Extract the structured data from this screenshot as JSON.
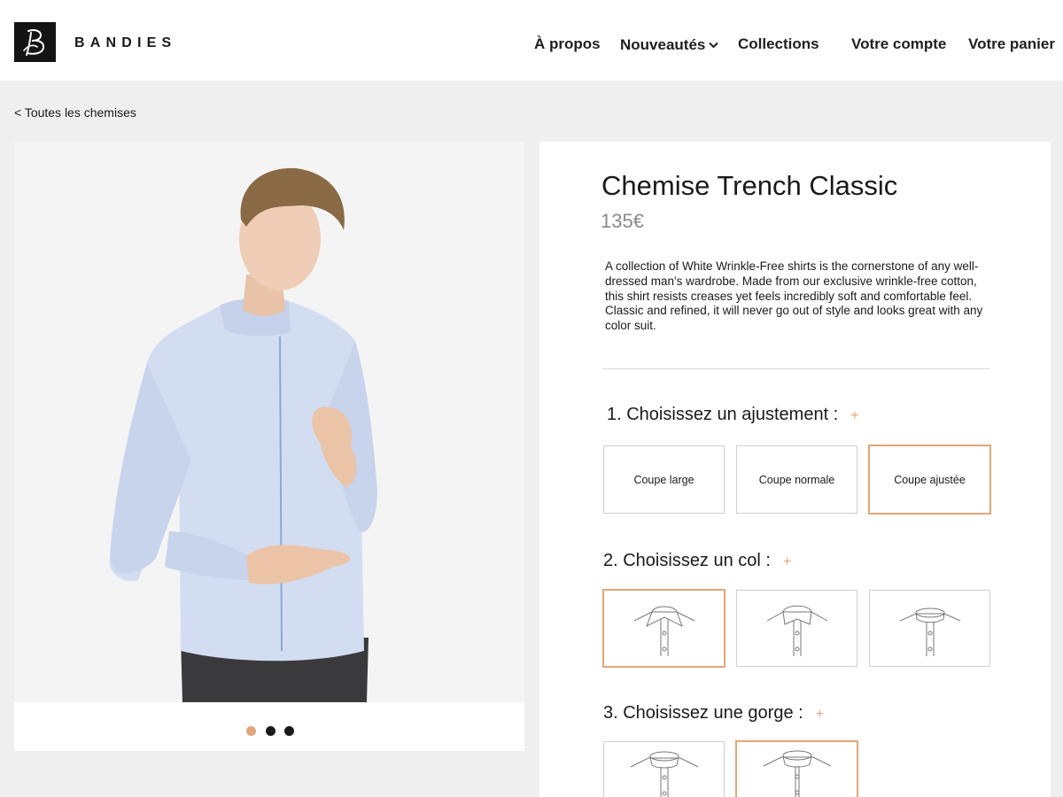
{
  "header": {
    "brand": "BANDIES",
    "logo_icon": "b-monogram-logo-icon",
    "nav": {
      "a_propos": "À propos",
      "nouveautes": "Nouveautés",
      "collections": "Collections",
      "compte": "Votre compte",
      "panier": "Votre panier"
    }
  },
  "breadcrumb": "< Toutes les chemises",
  "gallery": {
    "photo_icon": "model-wearing-shirt-photo",
    "dots_count": 3,
    "active_dot": 1
  },
  "product": {
    "title": "Chemise Trench Classic",
    "price": "135€",
    "description": "A collection of White Wrinkle-Free shirts is the cornerstone of any well-dressed man's wardrobe. Made from our exclusive wrinkle-free cotton, this shirt resists creases yet feels incredibly soft and comfortable feel. Classic and refined, it will never go out of style and looks great with any color suit."
  },
  "steps": {
    "fit": {
      "label": "1. Choisissez un ajustement :",
      "plus": "+",
      "options": [
        "Coupe large",
        "Coupe normale",
        "Coupe ajustée"
      ],
      "selected": "Coupe ajustée"
    },
    "collar": {
      "label": "2. Choisissez un col :",
      "plus": "+",
      "options_icons": [
        "classic-collar-icon",
        "cutaway-collar-icon",
        "mandarin-collar-icon"
      ],
      "selected_index": 0
    },
    "placket": {
      "label": "3. Choisissez une gorge :",
      "plus": "+",
      "options_icons": [
        "standard-placket-icon",
        "french-placket-icon"
      ],
      "selected_index": 1
    }
  },
  "colors": {
    "accent": "#e0a77a",
    "background": "#efefef",
    "text": "#1a1a1a",
    "price": "#8a8a8a"
  }
}
